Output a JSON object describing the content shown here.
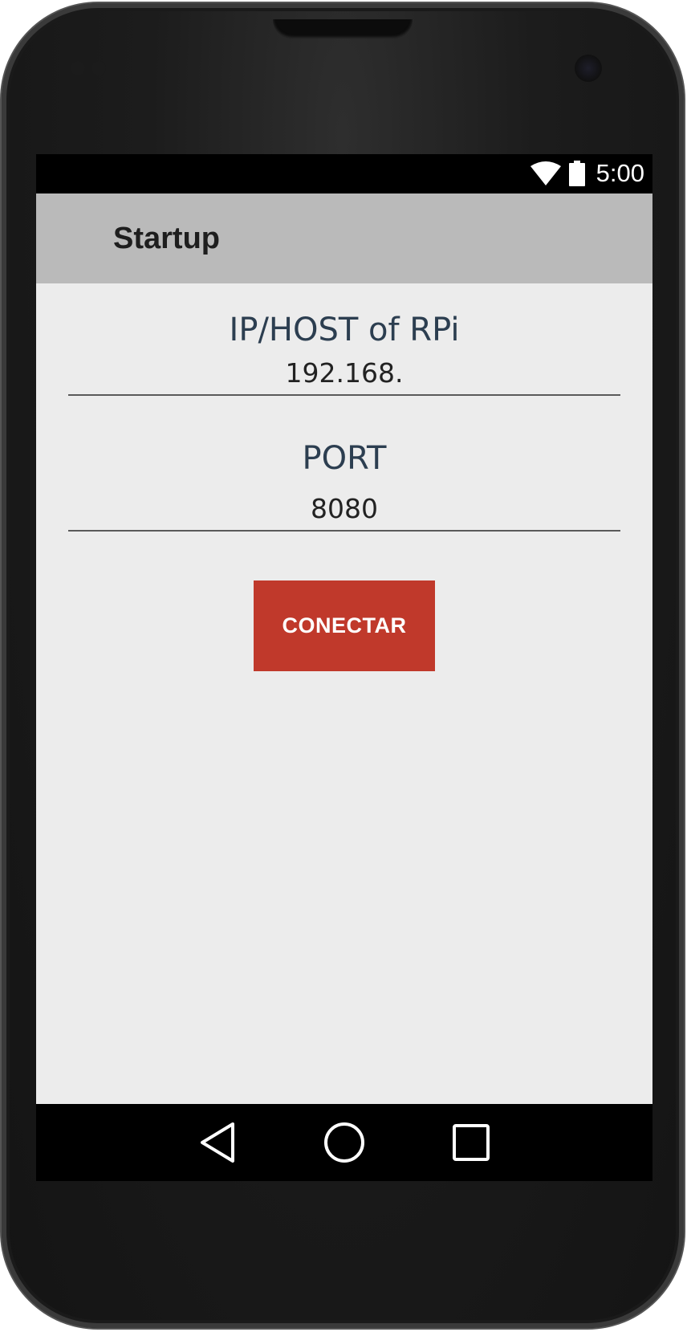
{
  "status_bar": {
    "time": "5:00",
    "icons": [
      "wifi-icon",
      "battery-icon"
    ]
  },
  "app_bar": {
    "title": "Startup"
  },
  "form": {
    "host": {
      "label": "IP/HOST of RPi",
      "value": "192.168."
    },
    "port": {
      "label": "PORT",
      "value": "8080"
    },
    "connect_label": "CONECTAR"
  },
  "nav_bar": {
    "icons": [
      "back-icon",
      "home-icon",
      "recents-icon"
    ]
  },
  "colors": {
    "app_bar": "#bababa",
    "background": "#ececec",
    "label_text": "#2c3e50",
    "button": "#c0392b"
  }
}
